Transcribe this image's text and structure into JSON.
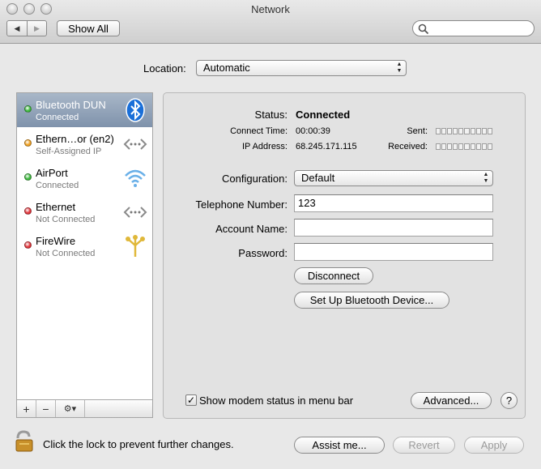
{
  "window": {
    "title": "Network"
  },
  "toolbar": {
    "show_all_label": "Show All",
    "back_icon": "◀",
    "forward_icon": "▶",
    "search_placeholder": ""
  },
  "location": {
    "label": "Location:",
    "value": "Automatic"
  },
  "services": [
    {
      "name": "Bluetooth DUN",
      "status": "Connected",
      "dot_color": "#3cb83c",
      "icon": "bluetooth-icon",
      "selected": true
    },
    {
      "name": "Ethern…or (en2)",
      "status": "Self-Assigned IP",
      "dot_color": "#f0a020",
      "icon": "ethernet-icon",
      "selected": false
    },
    {
      "name": "AirPort",
      "status": "Connected",
      "dot_color": "#3cb83c",
      "icon": "wifi-icon",
      "selected": false
    },
    {
      "name": "Ethernet",
      "status": "Not Connected",
      "dot_color": "#e0343a",
      "icon": "ethernet-icon",
      "selected": false
    },
    {
      "name": "FireWire",
      "status": "Not Connected",
      "dot_color": "#e0343a",
      "icon": "firewire-icon",
      "selected": false
    }
  ],
  "sidebar_footer": {
    "add": "+",
    "remove": "−",
    "action": "⚙▾"
  },
  "detail": {
    "status_label": "Status:",
    "status_value": "Connected",
    "connect_time_label": "Connect Time:",
    "connect_time_value": "00:00:39",
    "ip_label": "IP Address:",
    "ip_value": "68.245.171.115",
    "sent_label": "Sent:",
    "received_label": "Received:",
    "configuration_label": "Configuration:",
    "configuration_value": "Default",
    "telephone_label": "Telephone Number:",
    "telephone_value": "123",
    "account_label": "Account Name:",
    "account_value": "",
    "password_label": "Password:",
    "password_value": "",
    "disconnect_label": "Disconnect",
    "setup_bt_label": "Set Up Bluetooth Device...",
    "modem_status_label": "Show modem status in menu bar",
    "modem_status_checked": "✓",
    "advanced_label": "Advanced...",
    "help_label": "?"
  },
  "bottom": {
    "lock_text": "Click the lock to prevent further changes.",
    "assist_label": "Assist me...",
    "revert_label": "Revert",
    "apply_label": "Apply"
  },
  "colors": {
    "selection": "#7f92ab",
    "accent_blue": "#1a6fd8"
  }
}
